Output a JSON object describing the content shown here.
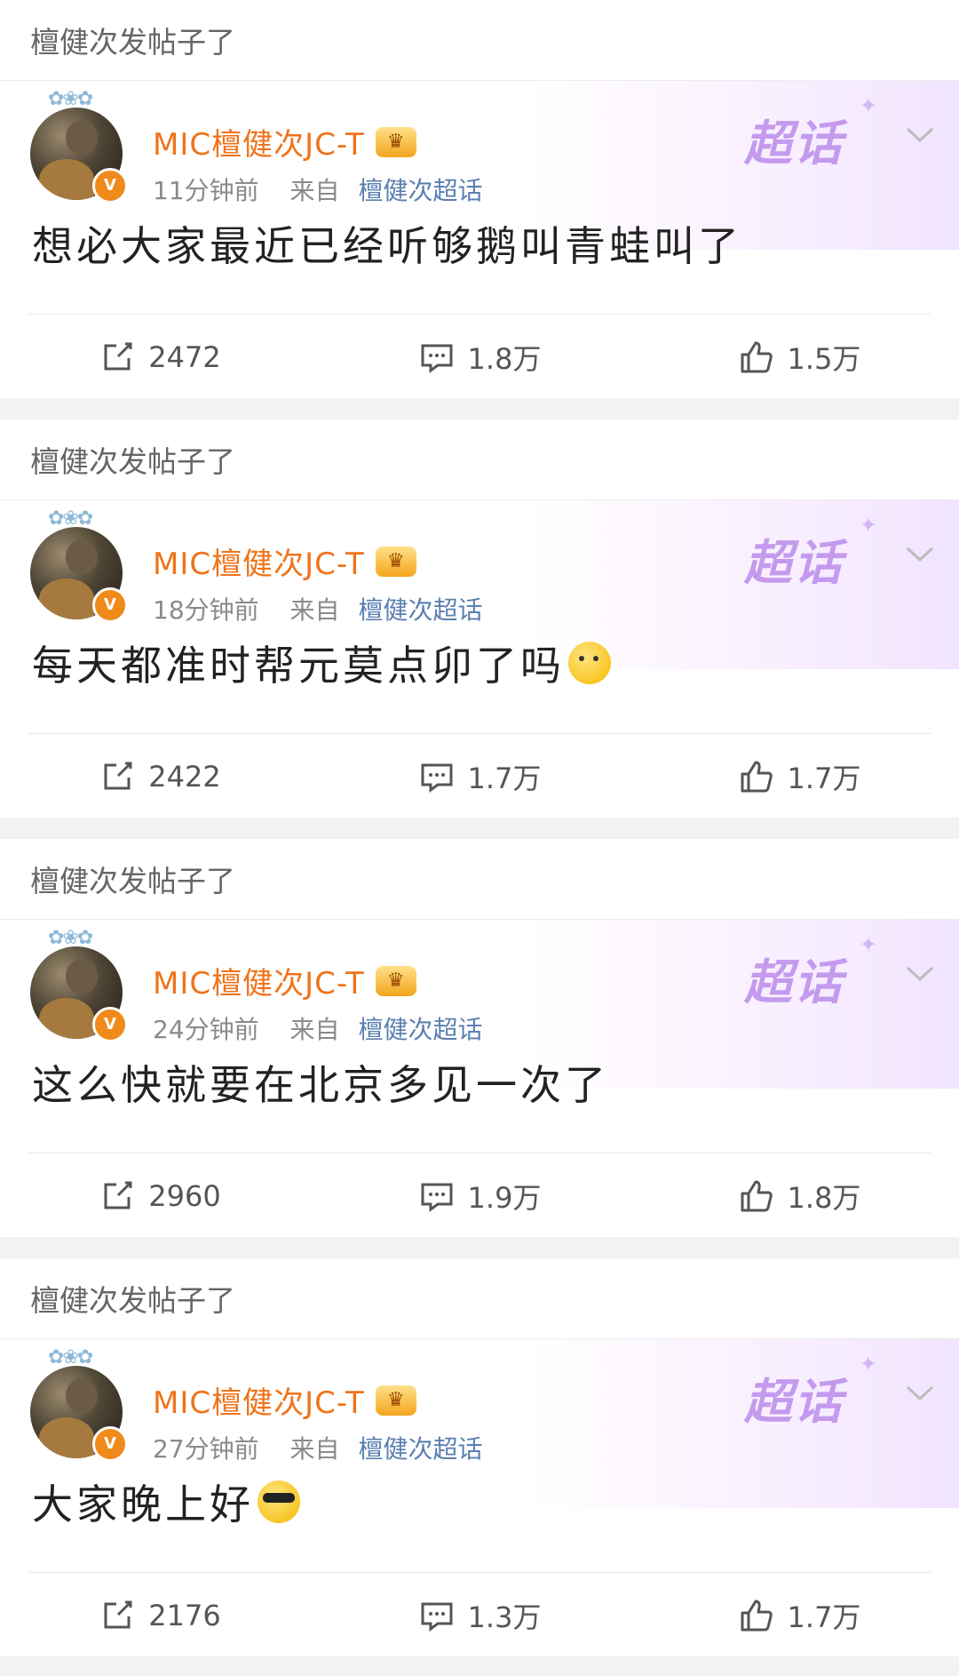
{
  "posts": [
    {
      "header": "檀健次发帖子了",
      "user": {
        "name": "MIC檀健次JC-T",
        "verified_badge": "V"
      },
      "time": "11分钟前",
      "from_label": "来自",
      "topic": "檀健次超话",
      "super_topic_badge": "超话",
      "text": "想必大家最近已经听够鹅叫青蛙叫了",
      "emoji": "",
      "repost_count": "2472",
      "comment_count": "1.8万",
      "like_count": "1.5万"
    },
    {
      "header": "檀健次发帖子了",
      "user": {
        "name": "MIC檀健次JC-T",
        "verified_badge": "V"
      },
      "time": "18分钟前",
      "from_label": "来自",
      "topic": "檀健次超话",
      "super_topic_badge": "超话",
      "text": "每天都准时帮元莫点卯了吗",
      "emoji": "thinking-face",
      "repost_count": "2422",
      "comment_count": "1.7万",
      "like_count": "1.7万"
    },
    {
      "header": "檀健次发帖子了",
      "user": {
        "name": "MIC檀健次JC-T",
        "verified_badge": "V"
      },
      "time": "24分钟前",
      "from_label": "来自",
      "topic": "檀健次超话",
      "super_topic_badge": "超话",
      "text": "这么快就要在北京多见一次了",
      "emoji": "",
      "repost_count": "2960",
      "comment_count": "1.9万",
      "like_count": "1.8万"
    },
    {
      "header": "檀健次发帖子了",
      "user": {
        "name": "MIC檀健次JC-T",
        "verified_badge": "V"
      },
      "time": "27分钟前",
      "from_label": "来自",
      "topic": "檀健次超话",
      "super_topic_badge": "超话",
      "text": "大家晚上好",
      "emoji": "sunglasses-face",
      "repost_count": "2176",
      "comment_count": "1.3万",
      "like_count": "1.7万"
    }
  ],
  "colors": {
    "username": "#f0731a",
    "topic_link": "#5b7fb0",
    "super_topic": "#c49aee",
    "verified": "#f08a1b"
  }
}
